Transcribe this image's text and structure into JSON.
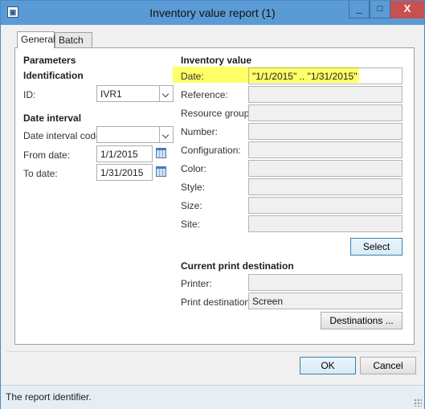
{
  "window": {
    "title": "Inventory value report (1)",
    "icon": "app-icon",
    "controls": {
      "minimize": "_",
      "maximize": "□",
      "close": "X"
    }
  },
  "tabs": [
    {
      "label": "General"
    },
    {
      "label": "Batch"
    }
  ],
  "left": {
    "parameters_heading": "Parameters",
    "identification_heading": "Identification",
    "id_label": "ID:",
    "id_value": "IVR1",
    "date_interval_heading": "Date interval",
    "date_interval_code_label": "Date interval code:",
    "date_interval_code_value": "",
    "from_date_label": "From date:",
    "from_date_value": "1/1/2015",
    "to_date_label": "To date:",
    "to_date_value": "1/31/2015"
  },
  "right": {
    "inventory_value_heading": "Inventory value",
    "date_label": "Date:",
    "date_value": "\"1/1/2015\" .. \"1/31/2015\"",
    "reference_label": "Reference:",
    "resource_group_label": "Resource group:",
    "number_label": "Number:",
    "configuration_label": "Configuration:",
    "color_label": "Color:",
    "style_label": "Style:",
    "size_label": "Size:",
    "site_label": "Site:",
    "select_button": "Select",
    "print_destination_heading": "Current print destination",
    "printer_label": "Printer:",
    "printer_value": "",
    "print_destination_label": "Print destination:",
    "print_destination_value": "Screen",
    "destinations_button": "Destinations ..."
  },
  "footer": {
    "ok_button": "OK",
    "cancel_button": "Cancel"
  },
  "status": {
    "text": "The report identifier."
  },
  "colors": {
    "titlebar": "#5b9bd5",
    "close": "#c75050",
    "highlight": "#ffff66"
  }
}
